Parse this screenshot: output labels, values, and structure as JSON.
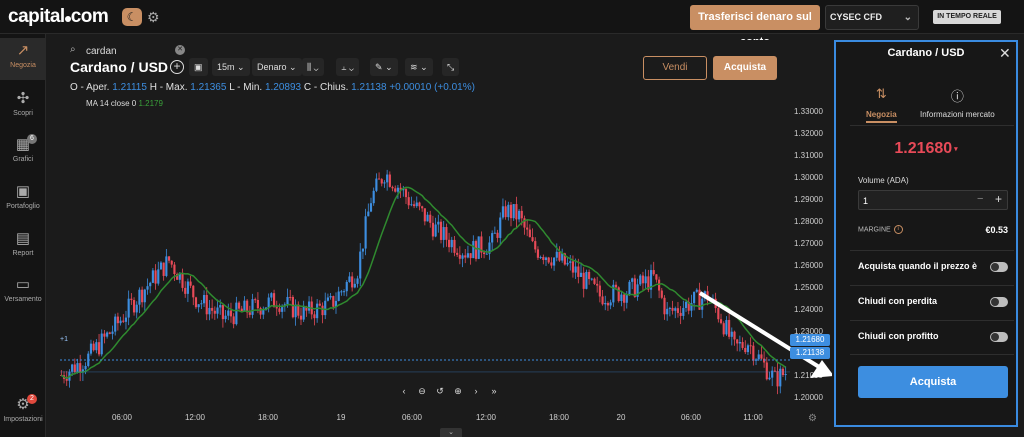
{
  "header": {
    "logo": "capital",
    "logo_suffix": "com",
    "transfer_label": "Trasferisci denaro sul conto",
    "account_label": "CYSEC CFD",
    "realtime_label": "IN TEMPO REALE",
    "accent_color": "#c98f63"
  },
  "sidebar": {
    "items": [
      {
        "label": "Negozia",
        "icon": "trend-icon"
      },
      {
        "label": "Scopri",
        "icon": "network-icon"
      },
      {
        "label": "Grafici",
        "icon": "chart-icon",
        "badge": "6"
      },
      {
        "label": "Portafoglio",
        "icon": "briefcase-icon"
      },
      {
        "label": "Report",
        "icon": "report-icon"
      },
      {
        "label": "Versamento",
        "icon": "wallet-icon"
      },
      {
        "label": "Impostazioni",
        "icon": "gear-icon",
        "badge": "2"
      }
    ]
  },
  "chart": {
    "search_value": "cardan",
    "title": "Cardano / USD",
    "timeframe": "15m",
    "price_type": "Denaro",
    "ohlc": {
      "open_label": "O - Aper.",
      "open": "1.21115",
      "high_label": "H - Max.",
      "high": "1.21365",
      "low_label": "L - Min.",
      "low": "1.20893",
      "close_label": "C - Chius.",
      "close": "1.21138",
      "change": "+0.00010 (+0.01%)"
    },
    "ma_label": "MA 14 close 0",
    "ma_value": "1.2179",
    "sell_label": "Vendi",
    "buy_label": "Acquista",
    "current_price_tag": "1.21680",
    "close_price_tag": "1.21138",
    "left_marker": "+1"
  },
  "chart_data": {
    "type": "candlestick",
    "y_ticks": [
      "1.33000",
      "1.32000",
      "1.31000",
      "1.30000",
      "1.29000",
      "1.28000",
      "1.27000",
      "1.26000",
      "1.25000",
      "1.24000",
      "1.23000",
      "1.22000",
      "1.21000",
      "1.20000"
    ],
    "ylim": [
      1.195,
      1.335
    ],
    "x_ticks": [
      "06:00",
      "12:00",
      "18:00",
      "19",
      "06:00",
      "12:00",
      "18:00",
      "20",
      "06:00",
      "11:00"
    ],
    "price_anchors": [
      [
        0,
        1.21
      ],
      [
        10,
        1.218
      ],
      [
        20,
        1.232
      ],
      [
        30,
        1.248
      ],
      [
        40,
        1.262
      ],
      [
        50,
        1.245
      ],
      [
        60,
        1.236
      ],
      [
        70,
        1.24
      ],
      [
        80,
        1.244
      ],
      [
        90,
        1.238
      ],
      [
        100,
        1.242
      ],
      [
        110,
        1.258
      ],
      [
        115,
        1.29
      ],
      [
        120,
        1.302
      ],
      [
        125,
        1.296
      ],
      [
        130,
        1.288
      ],
      [
        135,
        1.282
      ],
      [
        140,
        1.275
      ],
      [
        150,
        1.266
      ],
      [
        160,
        1.27
      ],
      [
        165,
        1.285
      ],
      [
        170,
        1.282
      ],
      [
        175,
        1.268
      ],
      [
        185,
        1.262
      ],
      [
        190,
        1.258
      ],
      [
        200,
        1.246
      ],
      [
        210,
        1.248
      ],
      [
        220,
        1.254
      ],
      [
        225,
        1.238
      ],
      [
        232,
        1.242
      ],
      [
        240,
        1.246
      ],
      [
        245,
        1.236
      ],
      [
        250,
        1.222
      ],
      [
        255,
        1.225
      ],
      [
        260,
        1.216
      ],
      [
        265,
        1.208
      ],
      [
        270,
        1.212
      ]
    ],
    "candle_count": 270,
    "bull_color": "#3d8ee0",
    "bear_color": "#e84a58",
    "ma_color": "#2f8a2f"
  },
  "panel": {
    "title": "Cardano / USD",
    "tab_trade": "Negozia",
    "tab_info": "Informazioni mercato",
    "price": "1.21680",
    "volume_label": "Volume (ADA)",
    "volume_value": "1",
    "margin_label": "MARGINE",
    "margin_value": "€0.53",
    "opt_buy_when": "Acquista quando il prezzo è",
    "opt_stop_loss": "Chiudi con perdita",
    "opt_take_profit": "Chiudi con profitto",
    "buy_label": "Acquista",
    "price_color": "#e84a58",
    "buy_color": "#3d8ee0"
  }
}
